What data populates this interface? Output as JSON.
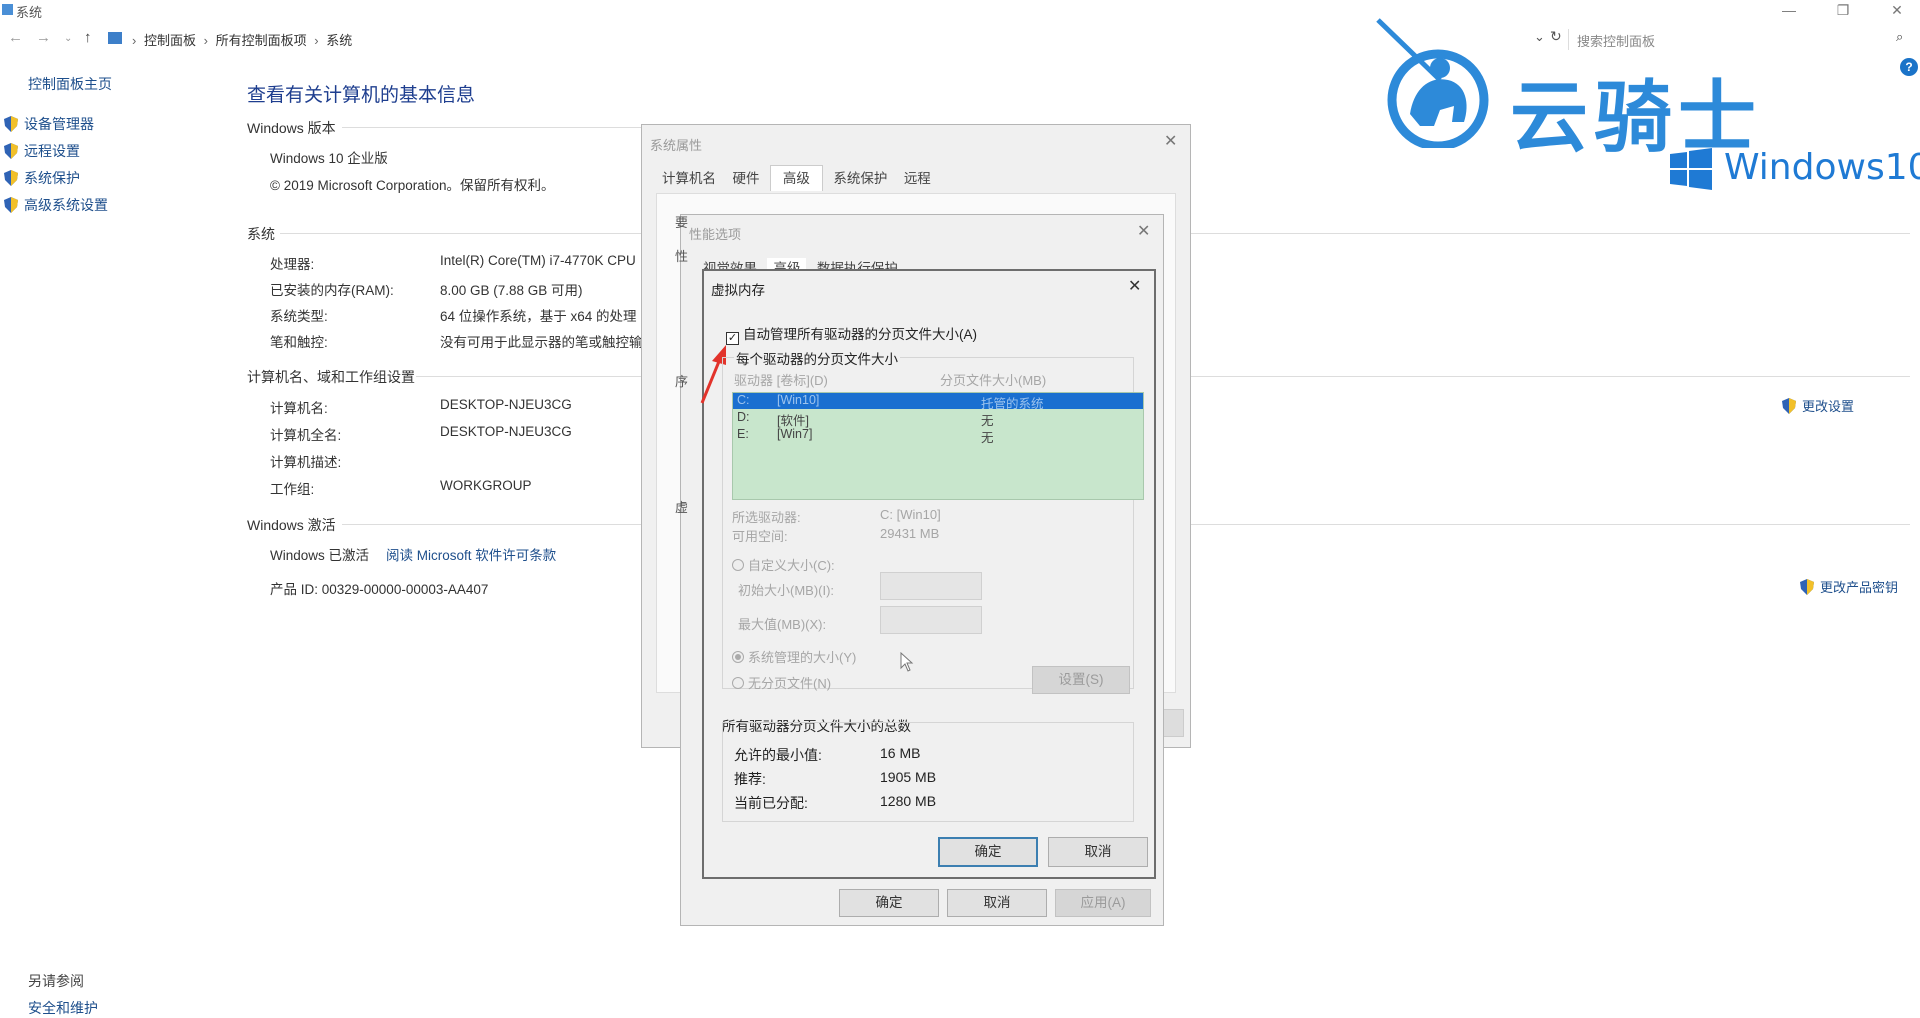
{
  "window": {
    "title": "系统"
  },
  "address": {
    "crumbs": [
      "控制面板",
      "所有控制面板项",
      "系统"
    ],
    "search_placeholder": "搜索控制面板"
  },
  "sidebar": {
    "home": "控制面板主页",
    "items": [
      {
        "label": "设备管理器"
      },
      {
        "label": "远程设置"
      },
      {
        "label": "系统保护"
      },
      {
        "label": "高级系统设置"
      }
    ],
    "see_also": "另请参阅",
    "security": "安全和维护"
  },
  "main": {
    "title": "查看有关计算机的基本信息",
    "edition_section": "Windows 版本",
    "edition": "Windows 10 企业版",
    "copyright": "© 2019 Microsoft Corporation。保留所有权利。",
    "system_section": "系统",
    "system_rows": [
      {
        "label": "处理器:",
        "value": "Intel(R) Core(TM) i7-4770K CPU"
      },
      {
        "label": "已安装的内存(RAM):",
        "value": "8.00 GB (7.88 GB 可用)"
      },
      {
        "label": "系统类型:",
        "value": "64 位操作系统，基于 x64 的处理"
      },
      {
        "label": "笔和触控:",
        "value": "没有可用于此显示器的笔或触控输"
      }
    ],
    "computer_section": "计算机名、域和工作组设置",
    "computer_rows": [
      {
        "label": "计算机名:",
        "value": "DESKTOP-NJEU3CG"
      },
      {
        "label": "计算机全名:",
        "value": "DESKTOP-NJEU3CG"
      },
      {
        "label": "计算机描述:",
        "value": ""
      },
      {
        "label": "工作组:",
        "value": "WORKGROUP"
      }
    ],
    "change_settings": "更改设置",
    "activation_section": "Windows 激活",
    "activated": "Windows 已激活",
    "license_link": "阅读 Microsoft 软件许可条款",
    "product_id": "产品 ID: 00329-00000-00003-AA407",
    "change_key": "更改产品密钥"
  },
  "sysprops": {
    "title": "系统属性",
    "tabs": [
      "计算机名",
      "硬件",
      "高级",
      "系统保护",
      "远程"
    ],
    "active_tab": "高级"
  },
  "perf": {
    "title": "性能选项",
    "tabs": [
      "视觉效果",
      "高级",
      "数据执行保护"
    ],
    "side_chars": [
      "要",
      "性",
      "序",
      "虚"
    ],
    "buttons": {
      "ok": "确定",
      "cancel": "取消",
      "apply": "应用(A)"
    }
  },
  "vm": {
    "title": "虚拟内存",
    "auto_manage": "自动管理所有驱动器的分页文件大小(A)",
    "auto_checked": true,
    "group_title": "每个驱动器的分页文件大小",
    "col_drive": "驱动器 [卷标](D)",
    "col_size": "分页文件大小(MB)",
    "drives": [
      {
        "letter": "C:",
        "label": "[Win10]",
        "size": "托管的系统",
        "selected": true
      },
      {
        "letter": "D:",
        "label": "[软件]",
        "size": "无",
        "selected": false
      },
      {
        "letter": "E:",
        "label": "[Win7]",
        "size": "无",
        "selected": false
      }
    ],
    "selected_drive_label": "所选驱动器:",
    "selected_drive_value": "C:  [Win10]",
    "free_space_label": "可用空间:",
    "free_space_value": "29431 MB",
    "custom_size": "自定义大小(C):",
    "initial_size": "初始大小(MB)(I):",
    "max_size": "最大值(MB)(X):",
    "system_managed": "系统管理的大小(Y)",
    "no_paging": "无分页文件(N)",
    "set_button": "设置(S)",
    "totals_title": "所有驱动器分页文件大小的总数",
    "totals": [
      {
        "label": "允许的最小值:",
        "value": "16 MB"
      },
      {
        "label": "推荐:",
        "value": "1905 MB"
      },
      {
        "label": "当前已分配:",
        "value": "1280 MB"
      }
    ],
    "ok": "确定",
    "cancel": "取消"
  },
  "watermark": {
    "brand": "云骑士",
    "os": "Windows10"
  },
  "colors": {
    "link": "#1e4f8c",
    "title": "#1e3e8f",
    "selection": "#1a6fd0",
    "list_bg": "#c8e6cc",
    "watermark": "#2d8ad9"
  }
}
